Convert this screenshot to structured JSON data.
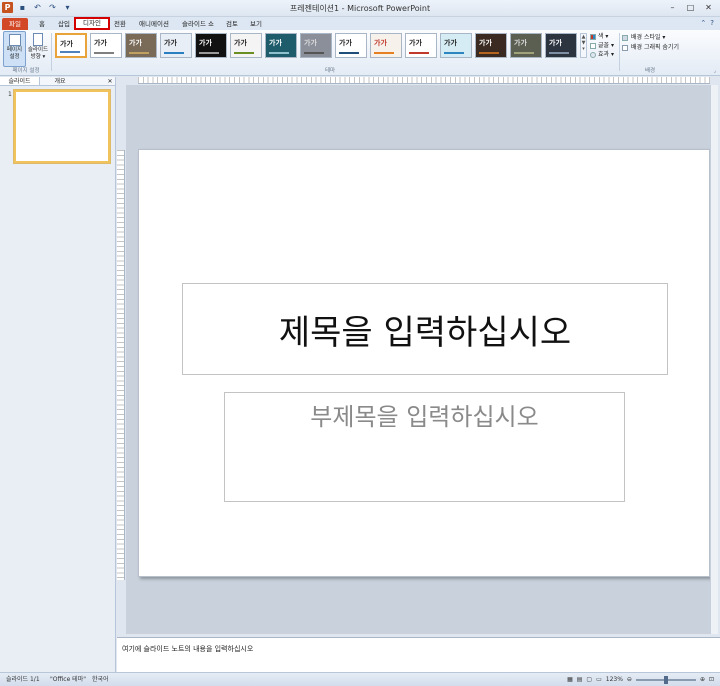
{
  "window": {
    "title": "프레젠테이션1 - Microsoft PowerPoint"
  },
  "qat": {
    "logo": "P",
    "save": "▪",
    "undo": "↶",
    "redo": "↷",
    "more": "▾"
  },
  "tabs": [
    {
      "key": "file",
      "label": "파일"
    },
    {
      "key": "home",
      "label": "홈"
    },
    {
      "key": "insert",
      "label": "삽입"
    },
    {
      "key": "design",
      "label": "디자인"
    },
    {
      "key": "transitions",
      "label": "전환"
    },
    {
      "key": "animations",
      "label": "애니메이션"
    },
    {
      "key": "slideshow",
      "label": "슬라이드 쇼"
    },
    {
      "key": "review",
      "label": "검토"
    },
    {
      "key": "view",
      "label": "보기"
    }
  ],
  "ribbon": {
    "page_setup": {
      "label1": "페이지",
      "label2": "설정"
    },
    "orientation": {
      "label1": "슬라이드",
      "label2": "방향 ▾"
    },
    "group_page_setup": "페이지 설정",
    "theme_sample_text": "가가",
    "group_themes": "테마",
    "colors_label": "색 ▾",
    "fonts_label": "글꼴 ▾",
    "effects_label": "효과 ▾",
    "bg_styles_label": "배경 스타일 ▾",
    "hide_bg_label": "배경 그래픽 숨기기",
    "group_background": "배경"
  },
  "themes": [
    {
      "bg": "#ffffff",
      "fg": "#222222",
      "bar": "#4f81bd",
      "selected": true
    },
    {
      "bg": "#ffffff",
      "fg": "#222222",
      "bar": "#7f7f7f",
      "selected": false
    },
    {
      "bg": "#7a6a58",
      "fg": "#ffffff",
      "bar": "#c0a060",
      "selected": false
    },
    {
      "bg": "#e8eef6",
      "fg": "#222222",
      "bar": "#2a7fc0",
      "selected": false
    },
    {
      "bg": "#111111",
      "fg": "#ffffff",
      "bar": "#999999",
      "selected": false
    },
    {
      "bg": "#f4f4f4",
      "fg": "#222222",
      "bar": "#6b8e23",
      "selected": false
    },
    {
      "bg": "#1f5c6b",
      "fg": "#ffffff",
      "bar": "#8fc1cc",
      "selected": false
    },
    {
      "bg": "#8a8f9a",
      "fg": "#dddddd",
      "bar": "#555555",
      "selected": false
    },
    {
      "bg": "#ffffff",
      "fg": "#222222",
      "bar": "#1f4e79",
      "selected": false
    },
    {
      "bg": "#f6f1ea",
      "fg": "#c0392b",
      "bar": "#e67e22",
      "selected": false
    },
    {
      "bg": "#ffffff",
      "fg": "#222222",
      "bar": "#c0392b",
      "selected": false
    },
    {
      "bg": "#d6ecf5",
      "fg": "#222222",
      "bar": "#2e86c1",
      "selected": false
    },
    {
      "bg": "#3b2a22",
      "fg": "#ffffff",
      "bar": "#b5651d",
      "selected": false
    },
    {
      "bg": "#5a5f52",
      "fg": "#dddddd",
      "bar": "#a0a37a",
      "selected": false
    },
    {
      "bg": "#2c3440",
      "fg": "#ffffff",
      "bar": "#7f8fa6",
      "selected": false
    }
  ],
  "panel": {
    "tab_slides": "슬라이드",
    "tab_outline": "개요",
    "close": "✕",
    "thumb_number": "1"
  },
  "slide": {
    "title": "제목을 입력하십시오",
    "subtitle": "부제목을 입력하십시오"
  },
  "notes": {
    "placeholder": "여기에 슬라이드 노트의 내용을 입력하십시오"
  },
  "status": {
    "slide_info": "슬라이드 1/1",
    "theme": "\"Office 테마\"",
    "language": "한국어",
    "zoom": "123%"
  }
}
